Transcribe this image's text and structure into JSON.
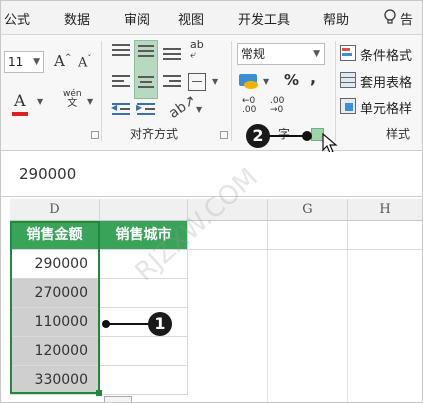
{
  "tabs": {
    "formulas": "公式",
    "data": "数据",
    "review": "审阅",
    "view": "视图",
    "developer": "开发工具",
    "help": "帮助",
    "tell_me": "告"
  },
  "ribbon": {
    "font_size_value": "11",
    "grow_font_label": "A",
    "shrink_font_label": "A",
    "font_color_label": "A",
    "phonetic_label": "wén",
    "phonetic_sub": "文",
    "alignment_group_label": "对齐方式",
    "number_format_value": "常规",
    "percent_label": "%",
    "comma_label": ",",
    "decimal_increase_top": "←0",
    "decimal_increase_bottom": ".00",
    "decimal_decrease_top": ".00",
    "decimal_decrease_bottom": "→0",
    "number_group_label": "字",
    "conditional_format": "条件格式",
    "format_as_table": "套用表格",
    "cell_styles": "单元格样",
    "styles_group_label": "样式",
    "wrap_label": "ab"
  },
  "formula_bar": {
    "value": "290000"
  },
  "sheet": {
    "columns": [
      "D",
      "",
      "",
      "G",
      "H"
    ],
    "header_row": [
      "销售金额",
      "销售城市"
    ],
    "rows": [
      "290000",
      "270000",
      "110000",
      "120000",
      "330000"
    ]
  },
  "callouts": {
    "one": "1",
    "two": "2"
  },
  "colors": {
    "header_green": "#3aa35a",
    "selection_gray": "#cfcfcf",
    "selection_border": "#1f8a3e"
  },
  "watermark": "RJZXW.COM"
}
